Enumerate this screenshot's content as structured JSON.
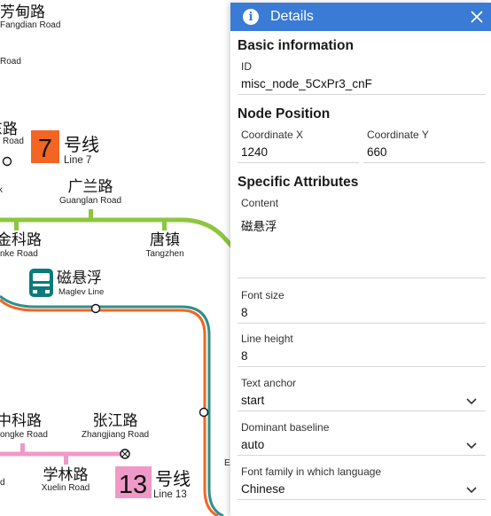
{
  "map": {
    "stations": [
      {
        "cn": "芳甸路",
        "en": "Fangdian Road"
      },
      {
        "en": "Road"
      },
      {
        "cn": "东路",
        "en": "Road"
      },
      {
        "cn": "广兰路",
        "en": "Guanglan Road"
      },
      {
        "cn": "金科路",
        "en": "nke Road"
      },
      {
        "cn": "唐镇",
        "en": "Tangzhen"
      },
      {
        "cn": "磁悬浮",
        "en": "Maglev Line"
      },
      {
        "cn": "中科路",
        "en": "ongke Road"
      },
      {
        "cn": "张江路",
        "en": "Zhangjiang Road"
      },
      {
        "cn": "学林路",
        "en": "Xuelin Road"
      },
      {
        "en": "d"
      },
      {
        "en": "k"
      },
      {
        "en": "E"
      }
    ],
    "line7": {
      "number": "7",
      "cn": "号线",
      "en": "Line 7",
      "color": "#f26522"
    },
    "line13": {
      "number": "13",
      "cn": "号线",
      "en": "Line 13",
      "color": "#f099c8"
    },
    "line2_color": "#8dc63f",
    "line16_color": "#2f8f8a",
    "maglev_color": "#0b7a7a"
  },
  "panel": {
    "title": "Details",
    "basic": {
      "heading": "Basic information",
      "id_label": "ID",
      "id_value": "misc_node_5CxPr3_cnF"
    },
    "position": {
      "heading": "Node Position",
      "x_label": "Coordinate X",
      "x_value": "1240",
      "y_label": "Coordinate Y",
      "y_value": "660"
    },
    "specific": {
      "heading": "Specific Attributes",
      "content_label": "Content",
      "content_value": "磁悬浮",
      "font_size_label": "Font size",
      "font_size_value": "8",
      "line_height_label": "Line height",
      "line_height_value": "8",
      "text_anchor_label": "Text anchor",
      "text_anchor_value": "start",
      "baseline_label": "Dominant baseline",
      "baseline_value": "auto",
      "font_family_label": "Font family in which language",
      "font_family_value": "Chinese"
    },
    "icons": {
      "info": "info-icon",
      "close": "close-icon",
      "dropdown": "chevron-down-icon"
    },
    "accent_color": "#3a7bd5"
  }
}
